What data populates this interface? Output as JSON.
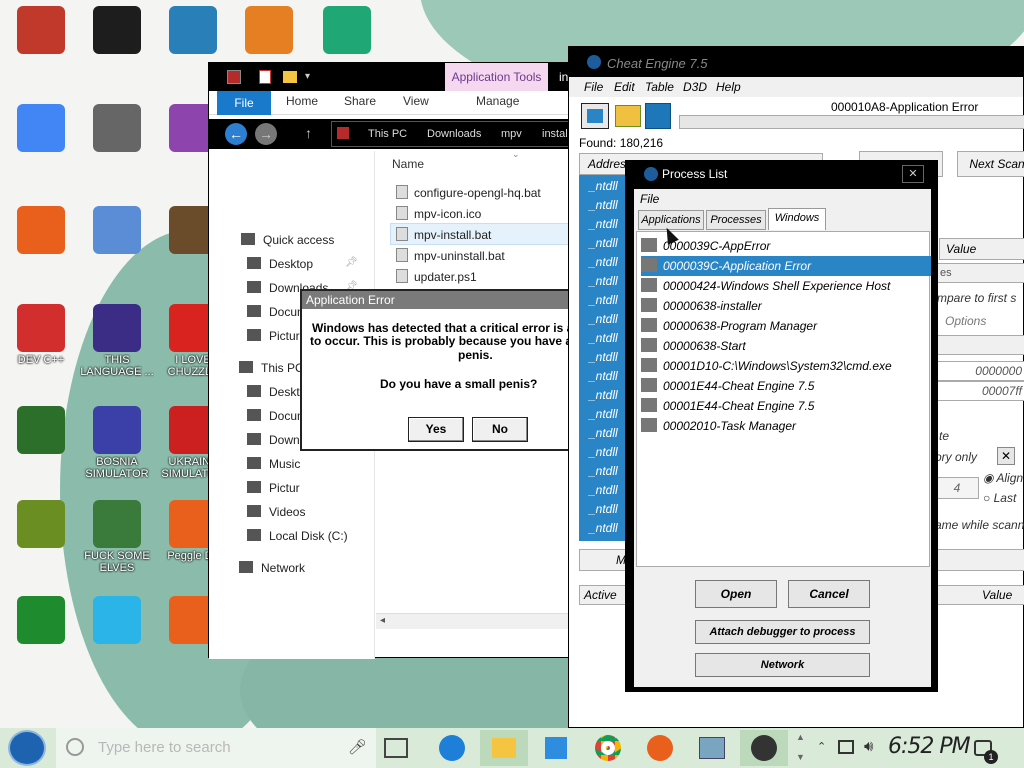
{
  "desktop": {
    "icons": [
      {
        "label": "",
        "color": "#c0392b"
      },
      {
        "label": "",
        "color": "#1d1d1d"
      },
      {
        "label": "",
        "color": "#2980b9"
      },
      {
        "label": "",
        "color": "#e67e22"
      },
      {
        "label": "",
        "color": "#1fa875"
      },
      {
        "label": "",
        "color": "#4285f4"
      },
      {
        "label": "",
        "color": "#666666"
      },
      {
        "label": "",
        "color": "#8e44ad"
      },
      {
        "label": "",
        "color": "#e8601c"
      },
      {
        "label": "",
        "color": "#5b8dd6"
      },
      {
        "label": "",
        "color": "#6b4c2a"
      },
      {
        "label": "DEV C++",
        "color": "#d22e2e"
      },
      {
        "label": "THIS LANGUAGE ...",
        "color": "#3b2c85"
      },
      {
        "label": "I LOVE CHUZZLE",
        "color": "#d8231e"
      },
      {
        "label": "",
        "color": "#2b6f2b"
      },
      {
        "label": "BOSNIA SIMULATOR",
        "color": "#3b3fa8"
      },
      {
        "label": "UKRAINE SIMULATOR",
        "color": "#cc1f1f"
      },
      {
        "label": "",
        "color": "#6b8e23"
      },
      {
        "label": "FUCK SOME ELVES",
        "color": "#3a7a3a"
      },
      {
        "label": "Peggle De",
        "color": "#e8601c"
      },
      {
        "label": "",
        "color": "#1e8c2e"
      },
      {
        "label": "",
        "color": "#2ab4e8"
      },
      {
        "label": "",
        "color": "#e8601c"
      }
    ]
  },
  "explorer": {
    "ribbon_tabs": [
      "File",
      "Home",
      "Share",
      "View"
    ],
    "app_tools_label": "Application Tools",
    "manage_label": "Manage",
    "title_extra": "in",
    "breadcrumb": [
      "This PC",
      "Downloads",
      "mpv",
      "instal"
    ],
    "nav_items": [
      {
        "label": "Quick access",
        "pin": false
      },
      {
        "label": "Desktop",
        "pin": true
      },
      {
        "label": "Downloads",
        "pin": true
      },
      {
        "label": "Documents",
        "pin": true
      },
      {
        "label": "Pictures",
        "pin": true
      },
      {
        "label": "This PC",
        "pin": false
      },
      {
        "label": "Deskt",
        "pin": false
      },
      {
        "label": "Docum",
        "pin": false
      },
      {
        "label": "Downl",
        "pin": false
      },
      {
        "label": "Music",
        "pin": false
      },
      {
        "label": "Pictur",
        "pin": false
      },
      {
        "label": "Videos",
        "pin": false
      },
      {
        "label": "Local Disk (C:)",
        "pin": false
      },
      {
        "label": "Network",
        "pin": false
      }
    ],
    "column_name": "Name",
    "files": [
      "configure-opengl-hq.bat",
      "mpv-icon.ico",
      "mpv-install.bat",
      "mpv-uninstall.bat",
      "updater.ps1"
    ]
  },
  "dialog": {
    "title": "Application Error",
    "line1": "Windows has detected that a critical error is a",
    "line2": "to occur. This is probably because you have a",
    "line3": "penis.",
    "question": "Do you have a small penis?",
    "yes": "Yes",
    "no": "No"
  },
  "cheat_engine": {
    "title": "Cheat Engine 7.5",
    "menu": [
      "File",
      "Edit",
      "Table",
      "D3D",
      "Help"
    ],
    "process_title": "000010A8-Application Error",
    "found": "Found: 180,216",
    "address_header": "Address",
    "next_scan": "Next Scan",
    "value_label": "Value",
    "compare_label": "mpare to first s",
    "options_label": "Options",
    "hex1": "0000000",
    "hex2": "00007ff",
    "te_label": "te",
    "ory_only": "ory only",
    "align_label": "Align",
    "last_label": "Last",
    "four": "4",
    "ame_label": "ame while scann",
    "active_header": "Active",
    "value_header": "Value",
    "m_btn": "M",
    "rows": [
      "_ntdll",
      "_ntdll",
      "_ntdll",
      "_ntdll",
      "_ntdll",
      "_ntdll",
      "_ntdll",
      "_ntdll",
      "_ntdll",
      "_ntdll",
      "_ntdll",
      "_ntdll",
      "_ntdll",
      "_ntdll",
      "_ntdll",
      "_ntdll",
      "_ntdll",
      "_ntdll",
      "_ntdll"
    ]
  },
  "process_list": {
    "title": "Process List",
    "menu_file": "File",
    "tabs": [
      "Applications",
      "Processes",
      "Windows"
    ],
    "active_tab": "Windows",
    "items": [
      "0000039C-AppError",
      "0000039C-Application Error",
      "00000424-Windows Shell Experience Host",
      "00000638-installer",
      "00000638-Program Manager",
      "00000638-Start",
      "00001D10-C:\\Windows\\System32\\cmd.exe",
      "00001E44-Cheat Engine 7.5",
      "00001E44-Cheat Engine 7.5",
      "00002010-Task Manager"
    ],
    "selected_index": 1,
    "buttons": {
      "open": "Open",
      "cancel": "Cancel",
      "attach": "Attach debugger to process",
      "network": "Network"
    }
  },
  "taskbar": {
    "search_placeholder": "Type here to search",
    "time": "6:52 PM",
    "notification_count": "1"
  }
}
